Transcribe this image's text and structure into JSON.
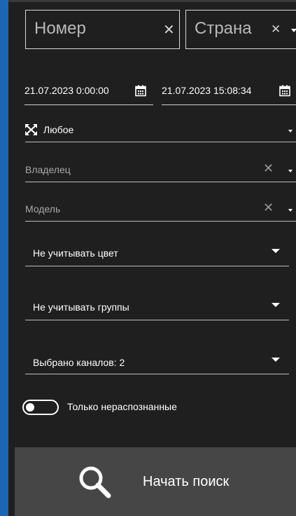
{
  "filters": {
    "number": {
      "placeholder": "Номер",
      "clear_icon": "close-icon"
    },
    "country": {
      "placeholder": "Страна",
      "clear_icon": "close-icon"
    },
    "date_from": "21.07.2023 0:00:00",
    "date_to": "21.07.2023 15:08:34",
    "direction": "Любое",
    "owner": {
      "placeholder": "Владелец"
    },
    "model": {
      "placeholder": "Модель"
    },
    "color": "Не учитывать цвет",
    "groups": "Не учитывать группы",
    "channels": "Выбрано каналов: 2",
    "only_unrecognized": {
      "label": "Только нераспознанные",
      "checked": false
    }
  },
  "search_button": {
    "label": "Начать поиск"
  },
  "colors": {
    "accent_frame": "#1b66b5",
    "background": "#1f1f1f",
    "button": "#464646"
  }
}
